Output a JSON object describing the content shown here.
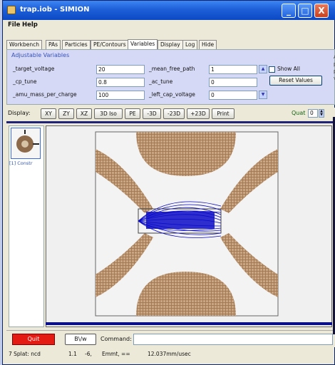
{
  "window": {
    "title": "trap.iob - SIMION",
    "min_symbol": "_",
    "max_symbol": "□",
    "close_symbol": "X"
  },
  "menu": {
    "file": "File",
    "help": "Help"
  },
  "tabs": [
    "Workbench",
    "PAs",
    "Particles",
    "PE/Contours",
    "Variables",
    "Display",
    "Log",
    "Hide"
  ],
  "active_tab": "Variables",
  "variables": {
    "heading": "Adjustable Variables",
    "rows": [
      {
        "left_name": "_target_voltage",
        "left_value": "20",
        "right_name": "_mean_free_path",
        "right_value": "1"
      },
      {
        "left_name": "_cp_tune",
        "left_value": "0.8",
        "right_name": "_ac_tune",
        "right_value": "0"
      },
      {
        "left_name": "_amu_mass_per_charge",
        "left_value": "100",
        "right_name": "_left_cap_voltage",
        "right_value": "0"
      }
    ],
    "show_all_label": "Show All",
    "reset_values_label": "Reset Values",
    "side_text": [
      "Ad",
      "pr",
      "pr",
      "va"
    ]
  },
  "display_bar": {
    "label": "Display:",
    "buttons": [
      "XY",
      "ZY",
      "XZ",
      "3D Iso",
      "PE",
      "-3D",
      "-23D",
      "+23D",
      "Print"
    ],
    "quad_label": "Quat",
    "quad_value": "0"
  },
  "instance_label": "[1] Constr",
  "bottom": {
    "quit_label": "Quit",
    "bw_label": "B\\/w",
    "command_label": "Command:",
    "command_value": ""
  },
  "status": {
    "splat": "7 Splat: ncd",
    "a": "1.1",
    "b": "-6,",
    "c": "Emmt, ==",
    "d": "12.037mm/usec"
  }
}
